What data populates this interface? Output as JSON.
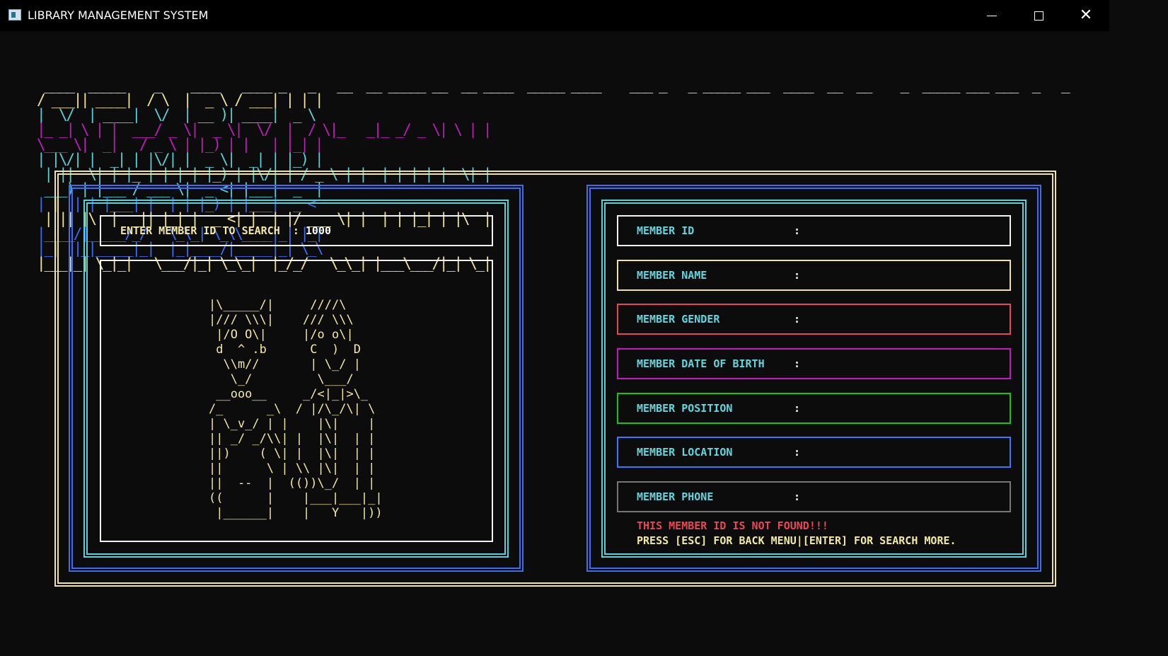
{
  "window": {
    "title": "LIBRARY MANAGEMENT SYSTEM"
  },
  "banner": {
    "text": "SEARCH MEMBER INFORMATION",
    "colors": [
      "#c21bbd",
      "#3b6df0",
      "#58d2d8",
      "#f1e39a"
    ]
  },
  "search": {
    "label": "ENTER MEMBER ID TO SEARCH  : ",
    "value": "1000"
  },
  "art": {
    "lines": [
      "|\\_____/|     ////\\",
      "|/// \\\\\\|    /// \\\\\\",
      " |/O O\\|     |/o o\\|",
      " d  ^ .b      C  )  D",
      "  \\\\m//       | \\_/ |",
      "   \\_/         \\___/",
      " __ooo__     _/<|_|>\\_",
      "/_      _\\  / |/\\_/\\| \\",
      "| \\_v_/ | |    |\\|    |",
      "|| _/ _/\\\\| |  |\\|  | |",
      "||)    ( \\| |  |\\|  | |",
      "||      \\ | \\\\ |\\|  | |",
      "||  --  |  (())\\_/  | |",
      "((      |    |___|___|_|",
      " |______|    |   Y   |))"
    ]
  },
  "details": {
    "fields": [
      {
        "label": "MEMBER ID",
        "border": "#f2f2f2"
      },
      {
        "label": "MEMBER NAME",
        "border": "#f1e39a"
      },
      {
        "label": "MEMBER GENDER",
        "border": "#e84856"
      },
      {
        "label": "MEMBER DATE OF BIRTH",
        "border": "#c21bbd"
      },
      {
        "label": "MEMBER POSITION",
        "border": "#16c60c"
      },
      {
        "label": "MEMBER LOCATION",
        "border": "#3b78ff"
      },
      {
        "label": "MEMBER PHONE",
        "border": "#767676"
      }
    ],
    "colon": ":",
    "error_message": "THIS MEMBER ID IS NOT FOUND!!!",
    "hint": "PRESS [ESC] FOR BACK MENU|[ENTER] FOR SEARCH MORE."
  },
  "colors": {
    "background": "#0c0c0c",
    "yellow": "#f1e39a",
    "cyan": "#58d2d8",
    "blue": "#3b6df0",
    "red": "#e84856"
  }
}
